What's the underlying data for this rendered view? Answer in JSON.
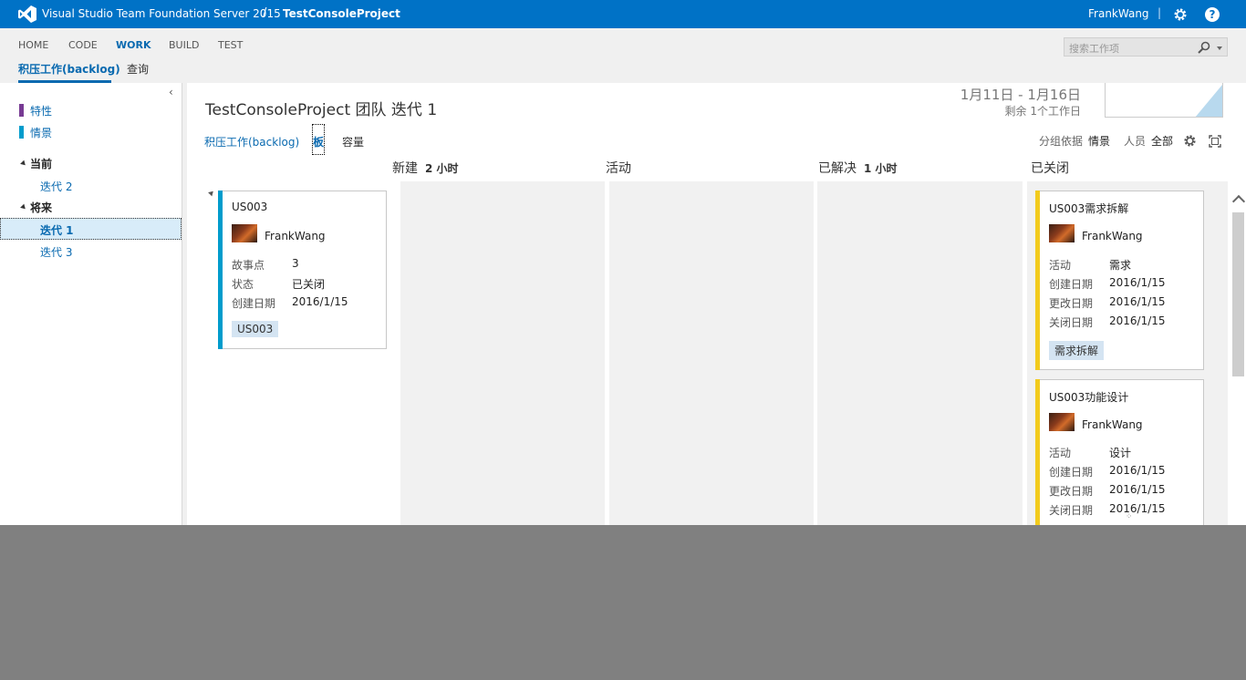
{
  "topbar": {
    "product": "Visual Studio Team Foundation Server 2015",
    "separator": "/",
    "project": "TestConsoleProject",
    "user": "FrankWang",
    "pipe": "|",
    "help": "?"
  },
  "nav": {
    "hubs": [
      "HOME",
      "CODE",
      "WORK",
      "BUILD",
      "TEST"
    ],
    "active_hub": "WORK",
    "subhubs": [
      "积压工作(backlog)",
      "查询"
    ],
    "search_placeholder": "搜索工作项"
  },
  "left": {
    "collapse": "‹",
    "backlogs": [
      {
        "label": "特性",
        "color": "#773b93"
      },
      {
        "label": "情景",
        "color": "#009ccc"
      }
    ],
    "current_header": "当前",
    "current_items": [
      "迭代 2"
    ],
    "future_header": "将来",
    "future_items": [
      "迭代 1",
      "迭代 3"
    ]
  },
  "main": {
    "title": "TestConsoleProject 团队 迭代 1",
    "date_range": "1月11日 - 1月16日",
    "remaining": "剩余 1个工作日",
    "pivots": [
      "积压工作(backlog)",
      "板",
      "容量"
    ],
    "group_label": "分组依据",
    "group_value": "情景",
    "people_label": "人员",
    "people_value": "全部",
    "columns": [
      {
        "name": "新建",
        "count": "2 小时"
      },
      {
        "name": "活动",
        "count": ""
      },
      {
        "name": "已解决",
        "count": "1 小时"
      },
      {
        "name": "已关闭",
        "count": ""
      }
    ],
    "resize_marks": "⁘"
  },
  "cards": {
    "story": {
      "title": "US003",
      "owner": "FrankWang",
      "fields": [
        {
          "label": "故事点",
          "value": "3"
        },
        {
          "label": "状态",
          "value": "已关闭"
        },
        {
          "label": "创建日期",
          "value": "2016/1/15"
        }
      ],
      "tag": "US003",
      "color": "#009ccc"
    },
    "task1": {
      "title": "US003需求拆解",
      "owner": "FrankWang",
      "fields": [
        {
          "label": "活动",
          "value": "需求"
        },
        {
          "label": "创建日期",
          "value": "2016/1/15"
        },
        {
          "label": "更改日期",
          "value": "2016/1/15"
        },
        {
          "label": "关闭日期",
          "value": "2016/1/15"
        }
      ],
      "tag": "需求拆解",
      "color": "#f2cb1d"
    },
    "task2": {
      "title": "US003功能设计",
      "owner": "FrankWang",
      "fields": [
        {
          "label": "活动",
          "value": "设计"
        },
        {
          "label": "创建日期",
          "value": "2016/1/15"
        },
        {
          "label": "更改日期",
          "value": "2016/1/15"
        },
        {
          "label": "关闭日期",
          "value": "2016/1/15"
        }
      ],
      "color": "#f2cb1d"
    }
  }
}
